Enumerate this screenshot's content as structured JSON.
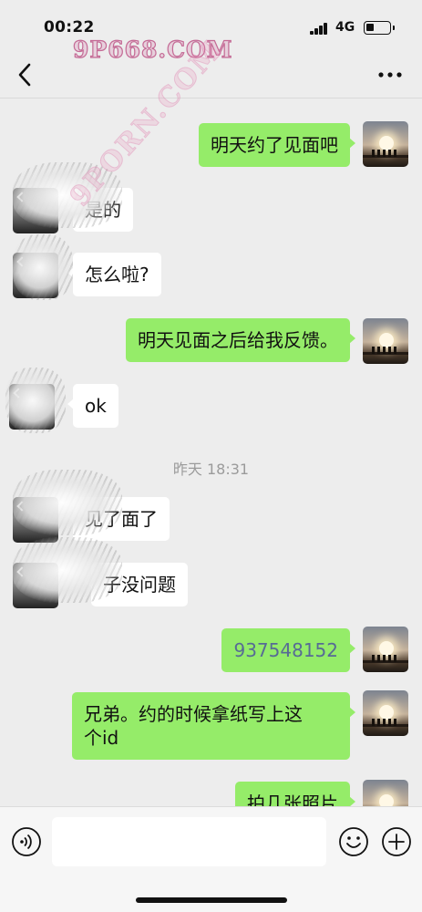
{
  "status_bar": {
    "time": "00:22",
    "network": "4G",
    "signal_icon": "signal-bars-icon",
    "battery_icon": "battery-icon",
    "battery_level": 0.25
  },
  "watermarks": {
    "top": "9P668.COM",
    "diagonal": "9PORN.COM"
  },
  "nav": {
    "back_icon": "chevron-left-icon",
    "more_icon": "more-dots-icon"
  },
  "messages": [
    {
      "sender": "self",
      "text": "明天约了见面吧"
    },
    {
      "sender": "other",
      "text": "是的"
    },
    {
      "sender": "other",
      "text": "怎么啦?"
    },
    {
      "sender": "self",
      "text": "明天见面之后给我反馈。"
    },
    {
      "sender": "other",
      "text": "ok"
    },
    {
      "type": "timestamp",
      "text": "昨天 18:31"
    },
    {
      "sender": "other",
      "text": "见了面了"
    },
    {
      "sender": "other",
      "text": "子没问题"
    },
    {
      "sender": "self",
      "text": "937548152",
      "style": "link"
    },
    {
      "sender": "self",
      "text": "兄弟。约的时候拿纸写上这\n个id"
    },
    {
      "sender": "self",
      "text": "拍几张照片"
    }
  ],
  "input_bar": {
    "voice_icon": "voice-icon",
    "emoji_icon": "emoji-icon",
    "plus_icon": "plus-icon",
    "input_value": ""
  },
  "colors": {
    "self_bubble": "#95ec69",
    "other_bubble": "#ffffff",
    "background": "#ededed",
    "link_text": "#576b95"
  }
}
